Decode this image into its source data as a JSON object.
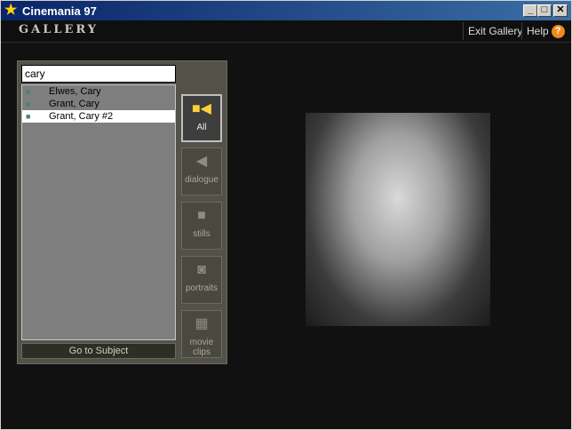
{
  "window": {
    "title": "Cinemania 97"
  },
  "header": {
    "gallery_title": "GALLERY",
    "exit_label": "Exit Gallery",
    "help_label": "Help",
    "help_icon_glyph": "?"
  },
  "search": {
    "value": "cary"
  },
  "results": [
    {
      "label": "Elwes, Cary",
      "icon": "camera-icon"
    },
    {
      "label": "Grant, Cary",
      "icon": "camera-icon"
    },
    {
      "label": "Grant, Cary #2",
      "icon": "camera-icon",
      "selected": true
    }
  ],
  "go_to_subject_label": "Go to Subject",
  "filters": [
    {
      "label": "All",
      "icon": "all-media-icon",
      "active": true
    },
    {
      "label": "dialogue",
      "icon": "speaker-icon"
    },
    {
      "label": "stills",
      "icon": "still-icon"
    },
    {
      "label": "portraits",
      "icon": "camera-icon"
    },
    {
      "label": "movie clips",
      "icon": "film-icon"
    }
  ],
  "colors": {
    "accent": "#f08a1c",
    "panel": "#535249"
  }
}
